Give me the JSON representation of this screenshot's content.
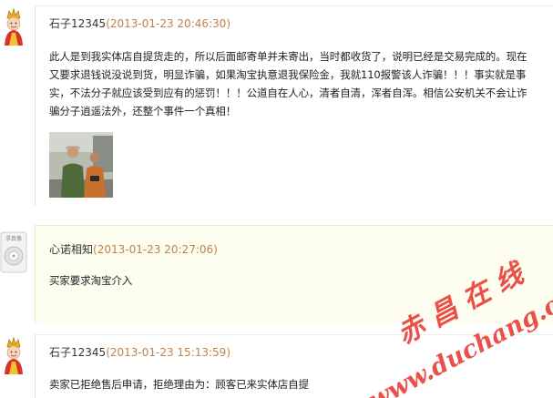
{
  "thread": {
    "posts": [
      {
        "author": "石子12345",
        "time": "(2013-01-23 20:46:30)",
        "lines": [
          "此人是到我实体店自提货走的，所以后面邮寄单并未寄出，当时都收货了，说明已经是交易完成的。现在",
          "又要求退钱说没说到货，明显诈骗，如果淘宝执意退我保险金，我就110报警该人诈骗！！！事实就是事",
          "实，不法分子就应该受到应有的惩罚！！！公道自在人心，清者自清，浑者自浑。相信公安机关不会让诈",
          "骗分子逍遥法外，还整个事件一个真相！"
        ]
      },
      {
        "author": "心诺相知",
        "time": "(2013-01-23 20:27:06)",
        "lines": [
          "买家要求淘宝介入"
        ]
      },
      {
        "author": "石子12345",
        "time": "(2013-01-23 15:13:59)",
        "lines": [
          "卖家已拒绝售后申请，拒绝理由为：顾客已来实体店自提"
        ]
      }
    ],
    "default_avatar_label": "求真像"
  },
  "watermark": {
    "line1": "赤 昌 在 线",
    "line2": "www.duchang.org"
  },
  "colors": {
    "time": "#c0834a",
    "watermark": "#e8312a",
    "highlight_bubble": "#fdfdf0"
  }
}
